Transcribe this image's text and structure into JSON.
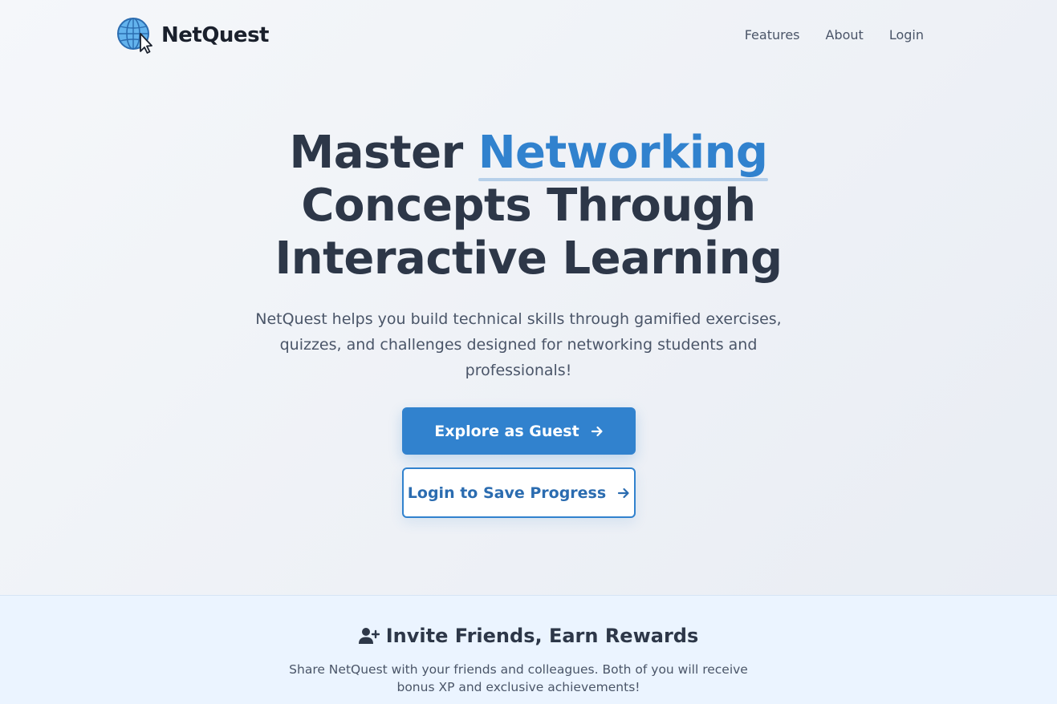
{
  "brand": {
    "name": "NetQuest",
    "logo_icon": "globe-cursor-icon"
  },
  "nav": {
    "items": [
      "Features",
      "About",
      "Login"
    ]
  },
  "hero": {
    "title_before": "Master",
    "title_highlight": "Networking",
    "title_line2": "Concepts Through",
    "title_line3": "Interactive Learning",
    "subtitle": "NetQuest helps you build technical skills through gamified exercises, quizzes, and challenges designed for networking students and professionals!",
    "primary_button": "Explore as Guest",
    "secondary_button": "Login to Save Progress"
  },
  "invite": {
    "icon": "user-plus-icon",
    "title": "Invite Friends, Earn Rewards",
    "text": "Share NetQuest with your friends and colleagues. Both of you will receive bonus XP and exclusive achievements!"
  },
  "colors": {
    "accent": "#3182ce",
    "text_dark": "#2d3748",
    "text_muted": "#4a5568",
    "invite_bg": "#ebf4ff"
  }
}
